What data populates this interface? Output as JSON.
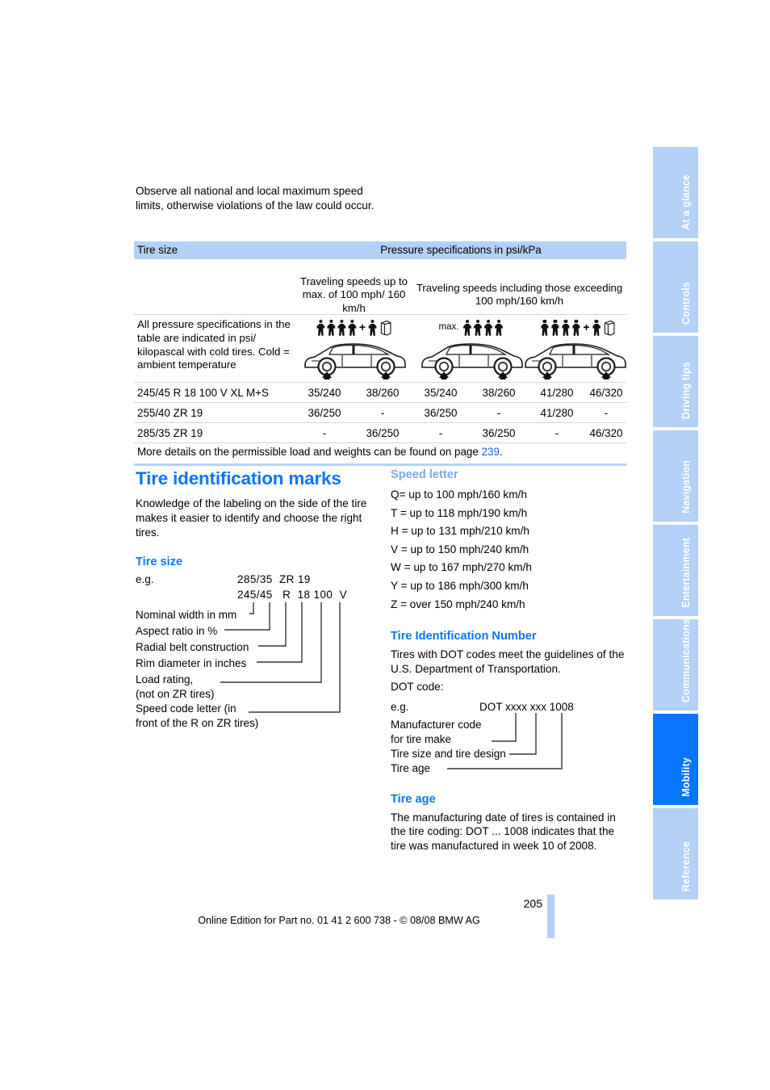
{
  "intro": {
    "text": "Observe all national and local maximum speed limits, otherwise violations of the law could occur."
  },
  "pressure_table": {
    "header_left": "Tire size",
    "header_right": "Pressure specifications in psi/kPa",
    "subheader_a": "Traveling speeds up to max. of 100 mph/ 160 km/h",
    "subheader_b": "Traveling speeds including those exceeding 100 mph/160 km/h",
    "note": "All pressure specifications in the table are indicated in psi/ kilopascal with cold tires. Cold = ambient temperature",
    "pictograms": [
      {
        "name": "four-persons-plus-one-and-luggage",
        "max_label": "",
        "persons_before_plus": 4,
        "persons_after_plus": 1,
        "luggage": true
      },
      {
        "name": "max-four-persons",
        "max_label": "max.",
        "persons_before_plus": 4,
        "persons_after_plus": 0,
        "luggage": false
      },
      {
        "name": "four-persons-plus-one-and-luggage",
        "max_label": "",
        "persons_before_plus": 4,
        "persons_after_plus": 1,
        "luggage": true
      }
    ],
    "rows": [
      {
        "tire": "245/45 R 18 100 V XL M+S",
        "values": [
          "35/240",
          "38/260",
          "35/240",
          "38/260",
          "41/280",
          "46/320"
        ]
      },
      {
        "tire": "255/40 ZR 19",
        "values": [
          "36/250",
          "-",
          "36/250",
          "-",
          "41/280",
          "-"
        ]
      },
      {
        "tire": "285/35 ZR 19",
        "values": [
          "-",
          "36/250",
          "-",
          "36/250",
          "-",
          "46/320"
        ]
      }
    ],
    "footnote_before": "More details on the permissible load and weights can be found on page ",
    "footnote_link": "239",
    "footnote_after": "."
  },
  "left_column": {
    "title": "Tire identification marks",
    "intro": "Knowledge of the labeling on the side of the tire makes it easier to identify and choose the right tires.",
    "tire_size_heading": "Tire size",
    "eg_label": "e.g.",
    "example_line1": "285/35  ZR 19",
    "example_line2": "245/45   R  18 100  V",
    "example_tokens_line1": [
      "285/35",
      "ZR",
      "19"
    ],
    "example_tokens_line2": [
      "245/45",
      "R",
      "18",
      "100",
      "V"
    ],
    "callouts": [
      "Nominal width in mm",
      "Aspect ratio in %",
      "Radial belt construction",
      "Rim diameter in inches",
      "Load rating,",
      "(not on ZR tires)",
      "Speed code letter (in",
      "front of the R on ZR tires)"
    ]
  },
  "right_column": {
    "speed_letter_heading": "Speed letter",
    "speed_letters": [
      "Q= up to 100 mph/160 km/h",
      "T = up to 118 mph/190 km/h",
      "H = up to 131 mph/210 km/h",
      "V = up to 150 mph/240 km/h",
      "W = up to 167 mph/270 km/h",
      "Y = up to 186 mph/300 km/h",
      "Z = over 150 mph/240 km/h"
    ],
    "tin_heading": "Tire Identification Number",
    "tin_text": "Tires with DOT codes meet the guidelines of the U.S. Department of Transportation.",
    "dot_code_label": "DOT code:",
    "eg_label": "e.g.",
    "dot_example": "DOT xxxx xxx 1008",
    "dot_callouts": [
      "Manufacturer code",
      "for tire make",
      "Tire size and tire design",
      "Tire age"
    ],
    "tire_age_heading": "Tire age",
    "tire_age_text": "The manufacturing date of tires is contained in the tire coding: DOT ... 1008 indicates that the tire was manufactured in week 10 of 2008."
  },
  "tabs": [
    {
      "label": "At a glance",
      "active": false
    },
    {
      "label": "Controls",
      "active": false
    },
    {
      "label": "Driving tips",
      "active": false
    },
    {
      "label": "Navigation",
      "active": false
    },
    {
      "label": "Entertainment",
      "active": false
    },
    {
      "label": "Communications",
      "active": false
    },
    {
      "label": "Mobility",
      "active": true
    },
    {
      "label": "Reference",
      "active": false
    }
  ],
  "footer": {
    "page_number": "205",
    "edition_line": "Online Edition for Part no. 01 41 2 600 738 - © 08/08 BMW AG"
  },
  "colors": {
    "accent_blue": "#0a76fd",
    "pale_blue": "#b3d1f7",
    "light_heading_blue": "#7fa9e8",
    "link_blue": "#1a5cf0"
  }
}
